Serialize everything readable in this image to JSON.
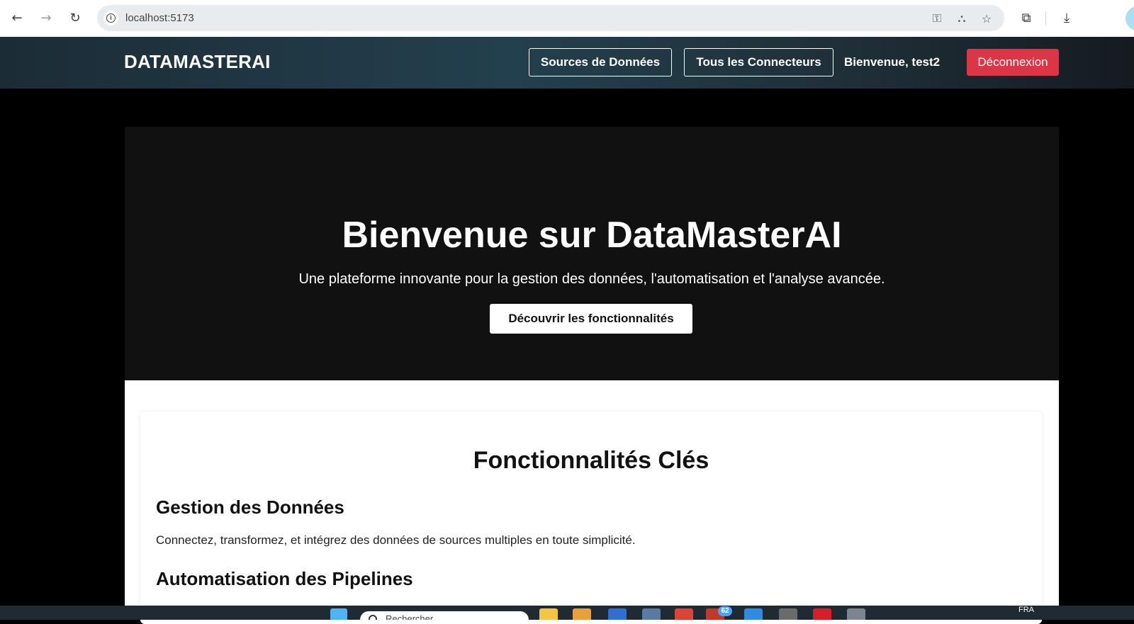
{
  "browser": {
    "url": "localhost:5173"
  },
  "header": {
    "brand": "DATAMASTERAI",
    "nav": {
      "sources": "Sources de Données",
      "connectors": "Tous les Connecteurs"
    },
    "welcome": "Bienvenue, test2",
    "logout": "Déconnexion"
  },
  "hero": {
    "title": "Bienvenue sur DataMasterAI",
    "subtitle": "Une plateforme innovante pour la gestion des données, l'automatisation et l'analyse avancée.",
    "cta": "Découvrir les fonctionnalités"
  },
  "features": {
    "title": "Fonctionnalités Clés",
    "items": [
      {
        "heading": "Gestion des Données",
        "text": "Connectez, transformez, et intégrez des données de sources multiples en toute simplicité."
      },
      {
        "heading": "Automatisation des Pipelines",
        "text": ""
      }
    ]
  },
  "taskbar": {
    "search_placeholder": "Rechercher",
    "badge_count": "62",
    "language": "FRA"
  },
  "colors": {
    "logout_bg": "#dc3545",
    "hero_bg": "#111111",
    "page_bg": "#000000"
  }
}
